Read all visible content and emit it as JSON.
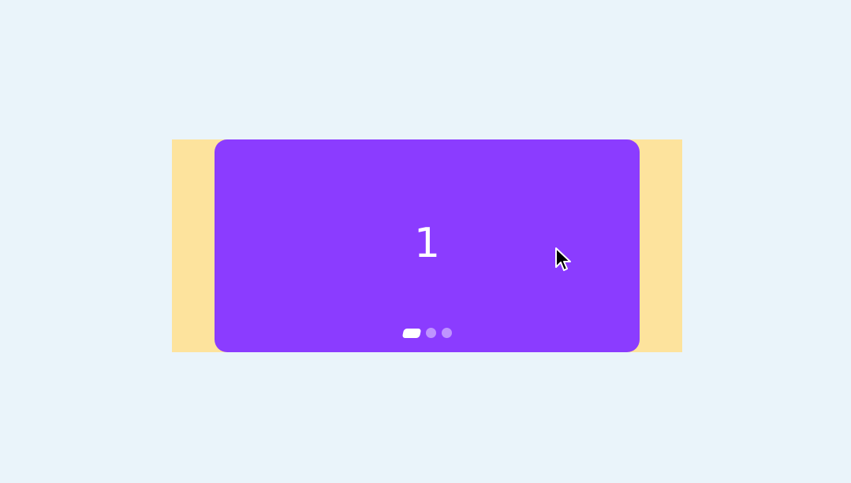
{
  "carousel": {
    "current_slide_label": "1",
    "slide_count": 3,
    "active_index": 0,
    "colors": {
      "page_background": "#eaf4fa",
      "track_background": "#fde39d",
      "slide_background": "#8b3cff",
      "text": "#ffffff",
      "dot_active": "#ffffff",
      "dot_inactive": "rgba(255,255,255,0.45)"
    }
  },
  "pointer": {
    "icon": "arrow-cursor-icon"
  }
}
